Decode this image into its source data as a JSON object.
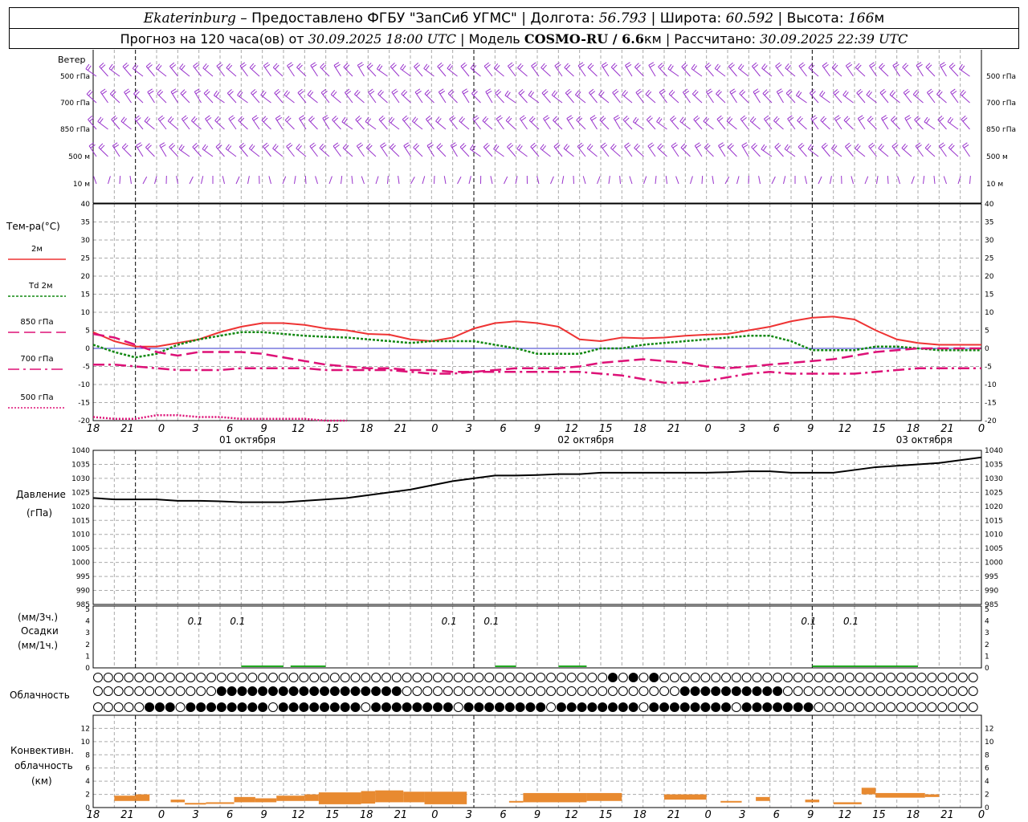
{
  "header": {
    "station": "Ekaterinburg",
    "provider": "– Предоставлено ФГБУ \"ЗапСиб УГМС\" |",
    "lon_label": "Долгота:",
    "lon": "56.793",
    "lat_label": "| Широта:",
    "lat": "60.592",
    "alt_label": "| Высота:",
    "alt": "166",
    "alt_unit": "м",
    "fc_label": "Прогноз на 120 часа(ов) от",
    "fc_time": "30.09.2025 18:00 UTC",
    "model_label": "| Модель",
    "model": "COSMO-RU / 6.6",
    "model_unit": "км",
    "calc_label": "| Рассчитано:",
    "calc_time": "30.09.2025 22:39 UTC"
  },
  "wind_panel": {
    "title": "Ветер",
    "levels": [
      "500 гПа",
      "700 гПа",
      "850 гПа",
      "500 м",
      "10 м"
    ],
    "color": "#9933cc"
  },
  "temp_panel": {
    "title": "Тем-ра(°С)",
    "legend": [
      {
        "label": "2м",
        "color": "#ee3333",
        "dash": ""
      },
      {
        "label": "Td 2м",
        "color": "#118811",
        "dash": "3,2"
      },
      {
        "label": "850 гПа",
        "color": "#dd1177",
        "dash": "14,6"
      },
      {
        "label": "700 гПа",
        "color": "#dd1177",
        "dash": "14,5,3,5"
      },
      {
        "label": "500 гПа",
        "color": "#dd1177",
        "dash": "2,2"
      }
    ],
    "ylim": [
      -20,
      40
    ],
    "yticks": [
      "40",
      "35",
      "30",
      "25",
      "20",
      "15",
      "10",
      "5",
      "0",
      "-5",
      "-10",
      "-15",
      "-20"
    ]
  },
  "pressure_panel": {
    "title_1": "Давление",
    "title_2": "(гПа)",
    "ylim": [
      985,
      1040
    ],
    "yticks": [
      "1040",
      "1035",
      "1030",
      "1025",
      "1020",
      "1015",
      "1010",
      "1005",
      "1000",
      "995",
      "990",
      "985"
    ]
  },
  "precip_panel": {
    "unit_top": "(мм/3ч.)",
    "title": "Осадки",
    "unit_bottom": "(мм/1ч.)",
    "yticks": [
      "5",
      "4",
      "3",
      "2",
      "1",
      "0"
    ],
    "annotations": [
      "0.1",
      "0.1",
      "0.1",
      "0.1",
      "0.1",
      "0.1"
    ]
  },
  "cloud_panel": {
    "title": "Облачность"
  },
  "conv_panel": {
    "title_1": "Конвективн.",
    "title_2": "облачность",
    "title_3": "(км)",
    "yticks": [
      "12",
      "10",
      "8",
      "6",
      "4",
      "2",
      "0"
    ],
    "color": "#e88a30"
  },
  "time_axis": {
    "hour_labels": [
      "18",
      "21",
      "0",
      "3",
      "6",
      "9",
      "12",
      "15",
      "18",
      "21",
      "0",
      "3",
      "6",
      "9",
      "12",
      "15",
      "18",
      "21",
      "0",
      "3",
      "6",
      "9",
      "12",
      "15",
      "18",
      "21",
      "0"
    ],
    "dates": [
      "01 октября",
      "02 октября",
      "03 октября"
    ]
  },
  "chart_data": {
    "type": "line",
    "x_hours": [
      0,
      3,
      6,
      9,
      12,
      15,
      18,
      21,
      24,
      27,
      30,
      33,
      36,
      39,
      42,
      45,
      48,
      51,
      54,
      57,
      60,
      63,
      66,
      69,
      72,
      75,
      78,
      81,
      84,
      87,
      90,
      93,
      96,
      99,
      102,
      105,
      108,
      111,
      114,
      117,
      120,
      123,
      126,
      129,
      132,
      135,
      138,
      141,
      144,
      147,
      150,
      153,
      156
    ],
    "series": [
      {
        "name": "2м",
        "values": [
          4.5,
          2,
          0.5,
          0.5,
          1.5,
          2.5,
          4.5,
          6,
          7,
          7,
          6.5,
          5.5,
          5,
          4,
          3.8,
          2.5,
          2,
          3,
          5.5,
          7,
          7.5,
          7,
          6,
          2.5,
          2,
          3,
          2.8,
          3,
          3.5,
          3.8,
          4,
          5,
          6,
          7.5,
          8.5,
          8.8,
          8,
          5,
          2.5,
          1.5,
          1,
          1,
          1
        ]
      },
      {
        "name": "Td 2м",
        "values": [
          1,
          -1,
          -2.5,
          -1.5,
          1,
          2.5,
          3.5,
          4.5,
          4.5,
          4,
          3.5,
          3.2,
          3,
          2.5,
          2,
          1.5,
          2,
          2,
          2,
          1,
          0,
          -1.5,
          -1.5,
          -1.5,
          0,
          0,
          1,
          1.5,
          2,
          2.5,
          3,
          3.5,
          3.5,
          2,
          -0.5,
          -0.5,
          -0.5,
          0.5,
          0.5,
          0,
          -0.5,
          -0.5,
          -0.5
        ]
      },
      {
        "name": "850 гПа",
        "values": [
          4,
          3,
          1,
          -1,
          -2,
          -1,
          -1,
          -1,
          -1.5,
          -2.5,
          -3.5,
          -4.5,
          -5,
          -5.5,
          -5.5,
          -6,
          -6,
          -6.5,
          -6.5,
          -6,
          -5.5,
          -5.5,
          -5.5,
          -5,
          -4,
          -3.5,
          -3,
          -3.5,
          -4,
          -5,
          -5.5,
          -5,
          -4.5,
          -4,
          -3.5,
          -3,
          -2,
          -1,
          -0.5,
          0,
          0,
          0,
          0
        ]
      },
      {
        "name": "700 гПа",
        "values": [
          -4.5,
          -4.5,
          -5,
          -5.5,
          -6,
          -6,
          -6,
          -5.5,
          -5.5,
          -5.5,
          -5.5,
          -6,
          -6,
          -6,
          -6,
          -6.5,
          -7,
          -7,
          -6.5,
          -6.5,
          -6.5,
          -6.5,
          -6.5,
          -6.5,
          -7,
          -7.5,
          -8.5,
          -9.5,
          -9.5,
          -9,
          -8,
          -7,
          -6.5,
          -7,
          -7,
          -7,
          -7,
          -6.5,
          -6,
          -5.5,
          -5.5,
          -5.5,
          -5.5
        ]
      },
      {
        "name": "500 гПа",
        "values": [
          -19,
          -19.5,
          -19.5,
          -18.5,
          -18.5,
          -19,
          -19,
          -19.5,
          -19.5,
          -19.5,
          -19.5,
          -20,
          -20
        ]
      },
      {
        "name": "Давление",
        "values": [
          1023,
          1022.5,
          1022.5,
          1022.5,
          1022,
          1022,
          1021.8,
          1021.5,
          1021.5,
          1021.5,
          1022,
          1022.5,
          1023,
          1024,
          1025,
          1026,
          1027.5,
          1029,
          1030,
          1031,
          1031,
          1031.2,
          1031.5,
          1031.5,
          1032,
          1032,
          1032,
          1032,
          1032,
          1032,
          1032.2,
          1032.5,
          1032.5,
          1032,
          1032,
          1032,
          1033,
          1034,
          1034.5,
          1035,
          1035.5,
          1036.5,
          1037.5
        ]
      }
    ],
    "xlim": [
      0,
      126
    ],
    "temp_ylim": [
      -20,
      40
    ],
    "pressure_ylim": [
      985,
      1040
    ]
  }
}
